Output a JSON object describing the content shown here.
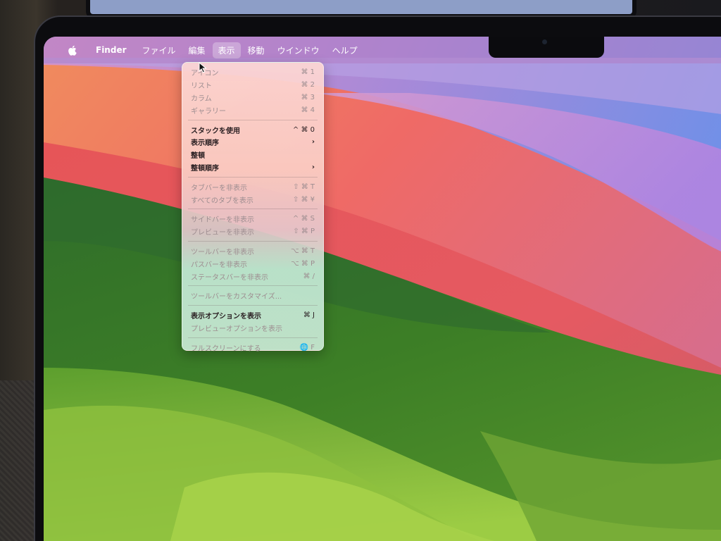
{
  "menubar": {
    "apple_icon": "apple-logo",
    "items": [
      {
        "label": "Finder",
        "bold": true
      },
      {
        "label": "ファイル"
      },
      {
        "label": "編集"
      },
      {
        "label": "表示",
        "active": true
      },
      {
        "label": "移動"
      },
      {
        "label": "ウインドウ"
      },
      {
        "label": "ヘルプ"
      }
    ]
  },
  "view_menu": {
    "groups": [
      [
        {
          "label": "アイコン",
          "shortcut": "⌘ 1",
          "enabled": false
        },
        {
          "label": "リスト",
          "shortcut": "⌘ 2",
          "enabled": false
        },
        {
          "label": "カラム",
          "shortcut": "⌘ 3",
          "enabled": false
        },
        {
          "label": "ギャラリー",
          "shortcut": "⌘ 4",
          "enabled": false
        }
      ],
      [
        {
          "label": "スタックを使用",
          "shortcut": "^ ⌘ 0",
          "enabled": true
        },
        {
          "label": "表示順序",
          "shortcut": "›",
          "enabled": true
        },
        {
          "label": "整頓",
          "shortcut": "",
          "enabled": true
        },
        {
          "label": "整頓順序",
          "shortcut": "›",
          "enabled": true
        }
      ],
      [
        {
          "label": "タブバーを非表示",
          "shortcut": "⇧ ⌘ T",
          "enabled": false
        },
        {
          "label": "すべてのタブを表示",
          "shortcut": "⇧ ⌘ ¥",
          "enabled": false
        }
      ],
      [
        {
          "label": "サイドバーを非表示",
          "shortcut": "^ ⌘ S",
          "enabled": false
        },
        {
          "label": "プレビューを非表示",
          "shortcut": "⇧ ⌘ P",
          "enabled": false
        }
      ],
      [
        {
          "label": "ツールバーを非表示",
          "shortcut": "⌥ ⌘ T",
          "enabled": false
        },
        {
          "label": "パスバーを非表示",
          "shortcut": "⌥ ⌘ P",
          "enabled": false
        },
        {
          "label": "ステータスバーを非表示",
          "shortcut": "⌘ /",
          "enabled": false
        }
      ],
      [
        {
          "label": "ツールバーをカスタマイズ...",
          "shortcut": "",
          "enabled": false
        }
      ],
      [
        {
          "label": "表示オプションを表示",
          "shortcut": "⌘ J",
          "enabled": true
        },
        {
          "label": "プレビューオプションを表示",
          "shortcut": "",
          "enabled": false
        }
      ],
      [
        {
          "label": "フルスクリーンにする",
          "shortcut": "🌐 F",
          "enabled": false
        }
      ]
    ]
  },
  "colors": {
    "menubar_bg": "#b07ec4",
    "wallpaper_red": "#e8505a",
    "wallpaper_green": "#5a9e2c",
    "wallpaper_blue": "#6b9de3"
  }
}
